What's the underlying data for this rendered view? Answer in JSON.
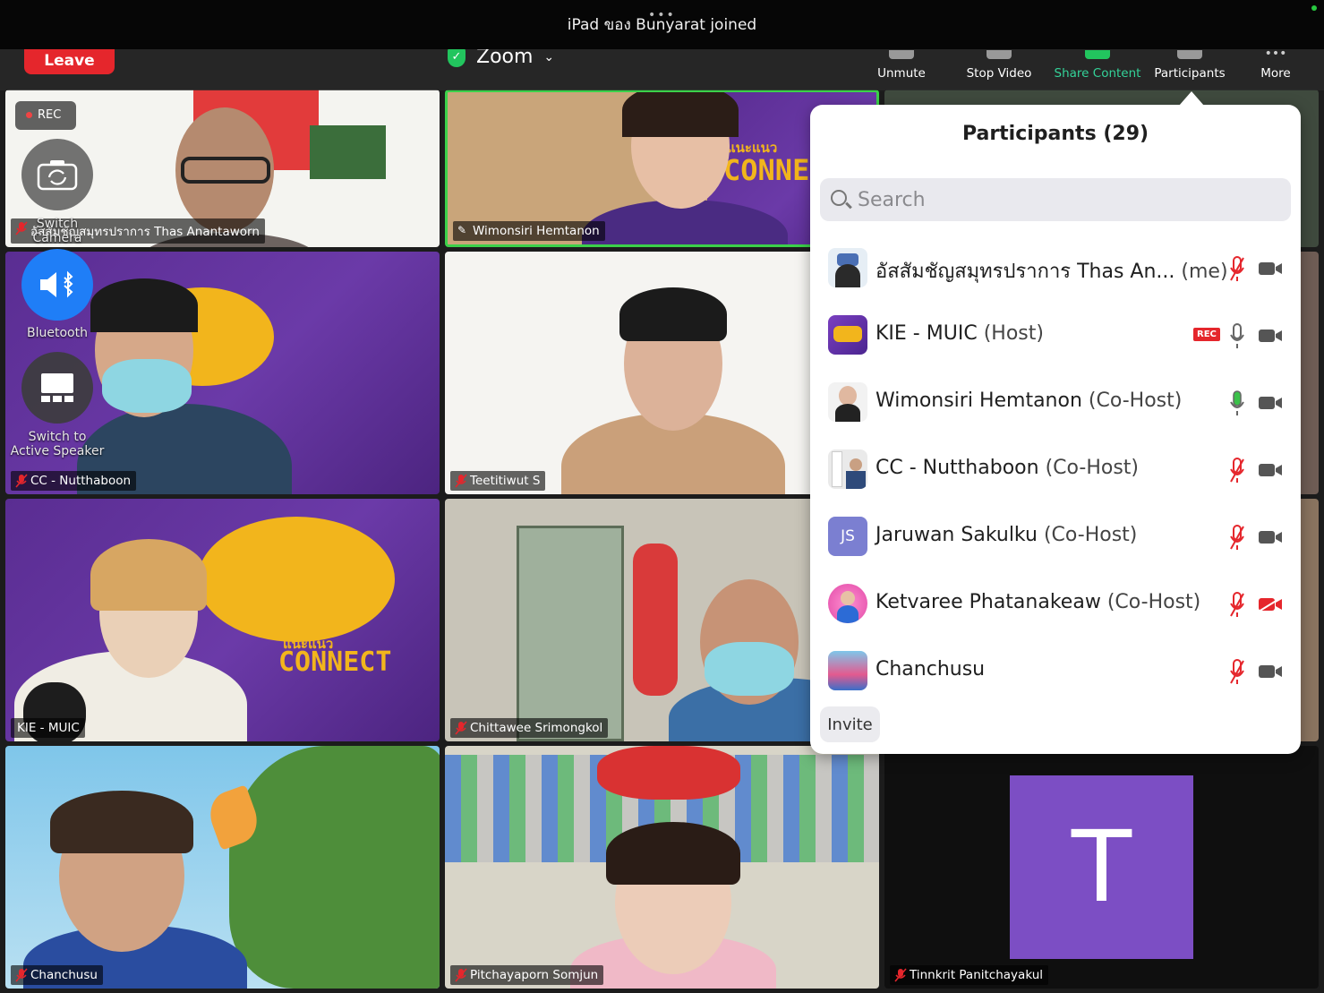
{
  "banner": {
    "text": "iPad ของ Bunyarat joined"
  },
  "toolbar": {
    "leave": "Leave",
    "title": "Zoom",
    "unmute": "Unmute",
    "stop_video": "Stop Video",
    "share_content": "Share Content",
    "participants": "Participants",
    "more": "More"
  },
  "overlay": {
    "rec": "REC",
    "switch_camera": "Switch Camera",
    "bluetooth": "Bluetooth",
    "switch_active_1": "Switch to",
    "switch_active_2": "Active Speaker"
  },
  "tiles": [
    {
      "name": "อัสสัมชัญสมุทรปราการ Thas Anantaworn"
    },
    {
      "name": "Wimonsiri Hemtanon"
    },
    {
      "name": "CC - Nutthaboon"
    },
    {
      "name": "Teetitiwut S"
    },
    {
      "name": "KIE - MUIC"
    },
    {
      "name": "Chittawee Srimongkol"
    },
    {
      "name": "Chanchusu"
    },
    {
      "name": "Pitchayaporn Somjun"
    },
    {
      "name": "Tinnkrit Panitchayakul",
      "initial": "T"
    }
  ],
  "tile_text": {
    "connect": "CONNECT",
    "connect_top": "แนะแนว",
    "connect_partial": "CONNEC",
    "connect_top_partial": "แนะแนว"
  },
  "participants_panel": {
    "title": "Participants (29)",
    "search_placeholder": "Search",
    "invite": "Invite",
    "rec_badge": "REC",
    "list": [
      {
        "name": "อัสสัมชัญสมุทรปราการ Thas An...",
        "role": "(me)",
        "mic": "muted",
        "cam": "on"
      },
      {
        "name": "KIE - MUIC",
        "role": "(Host)",
        "mic": "on",
        "cam": "on",
        "recording": true
      },
      {
        "name": "Wimonsiri Hemtanon",
        "role": "(Co-Host)",
        "mic": "speaking",
        "cam": "on"
      },
      {
        "name": "CC - Nutthaboon",
        "role": "(Co-Host)",
        "mic": "muted",
        "cam": "on"
      },
      {
        "name": "Jaruwan Sakulku",
        "role": "(Co-Host)",
        "mic": "muted",
        "cam": "on",
        "initials": "JS"
      },
      {
        "name": "Ketvaree Phatanakeaw",
        "role": "(Co-Host)",
        "mic": "muted",
        "cam": "off"
      },
      {
        "name": "Chanchusu",
        "role": "",
        "mic": "muted",
        "cam": "on"
      }
    ]
  },
  "colors": {
    "leave": "#e5262c",
    "share": "#22c55e",
    "muted": "#e5262c",
    "speaking": "#22c55e",
    "tile_avatar": "#7c4ec4"
  }
}
